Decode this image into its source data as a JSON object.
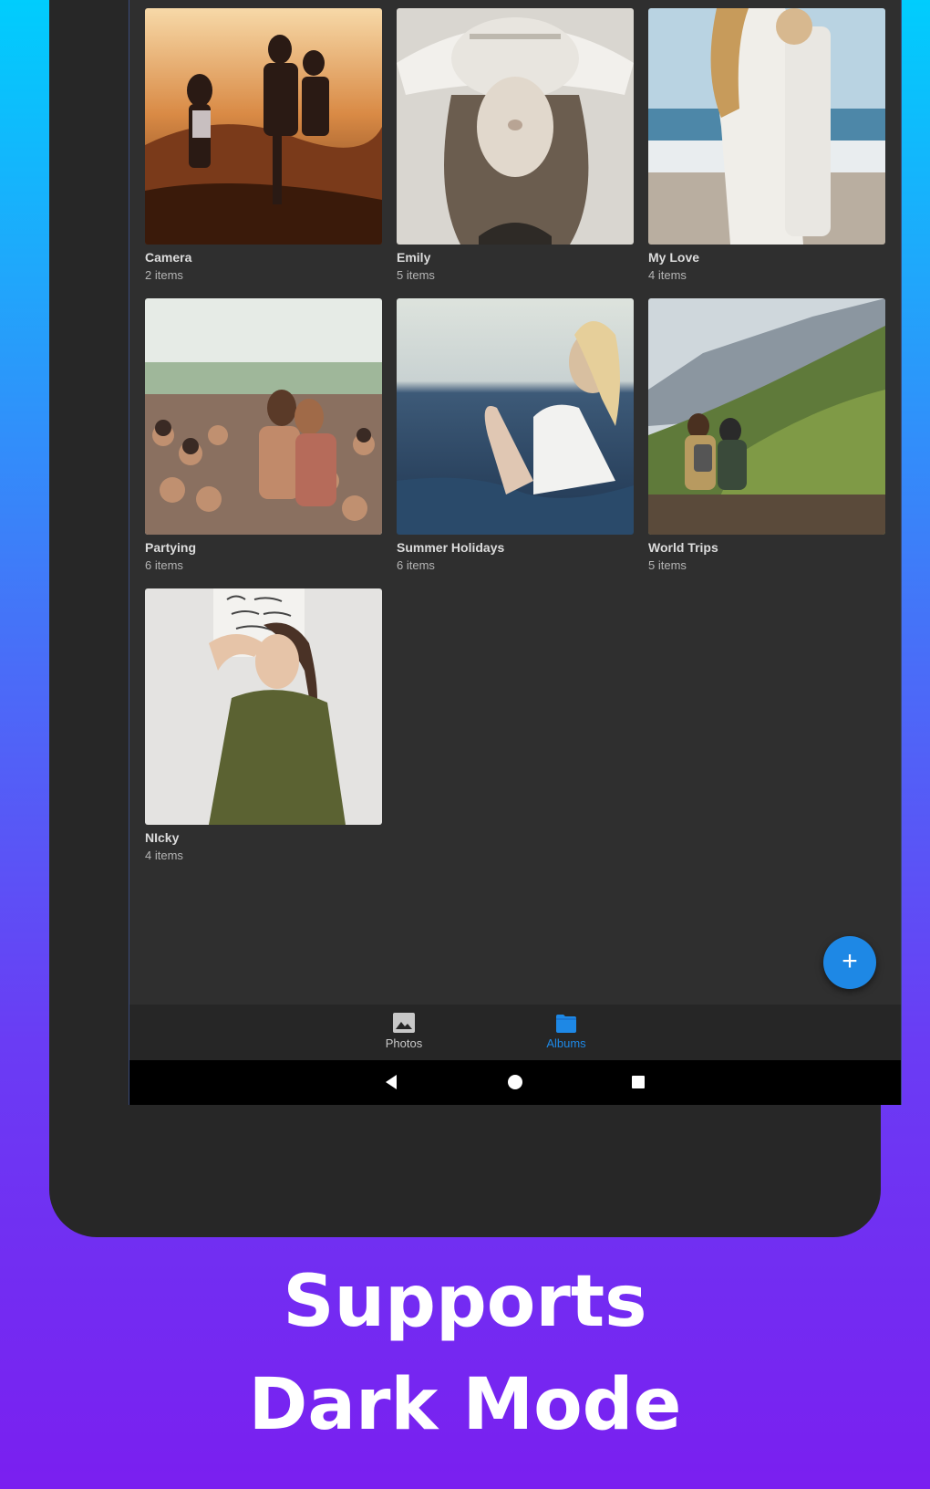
{
  "albums": [
    {
      "title": "Camera",
      "count": "2 items"
    },
    {
      "title": "Emily",
      "count": "5 items"
    },
    {
      "title": "My Love",
      "count": "4 items"
    },
    {
      "title": "Partying",
      "count": "6 items"
    },
    {
      "title": "Summer Holidays",
      "count": "6 items"
    },
    {
      "title": "World Trips",
      "count": "5 items"
    },
    {
      "title": "NIcky",
      "count": "4 items"
    }
  ],
  "fab": {
    "icon": "add-icon",
    "glyph": "+"
  },
  "bottom_nav": {
    "items": [
      {
        "label": "Photos",
        "icon": "image-icon",
        "active": false
      },
      {
        "label": "Albums",
        "icon": "folder-icon",
        "active": true
      }
    ],
    "active_color": "#1e88e5",
    "inactive_color": "#c8c8c8"
  },
  "system_nav": [
    "back-icon",
    "home-icon",
    "recents-icon"
  ],
  "headline": {
    "line1": "Supports",
    "line2": "Dark Mode"
  },
  "colors": {
    "background_top": "#00cdfd",
    "background_bottom": "#7a1ff0",
    "screen": "#2f2f2f",
    "accent": "#1e88e5"
  }
}
